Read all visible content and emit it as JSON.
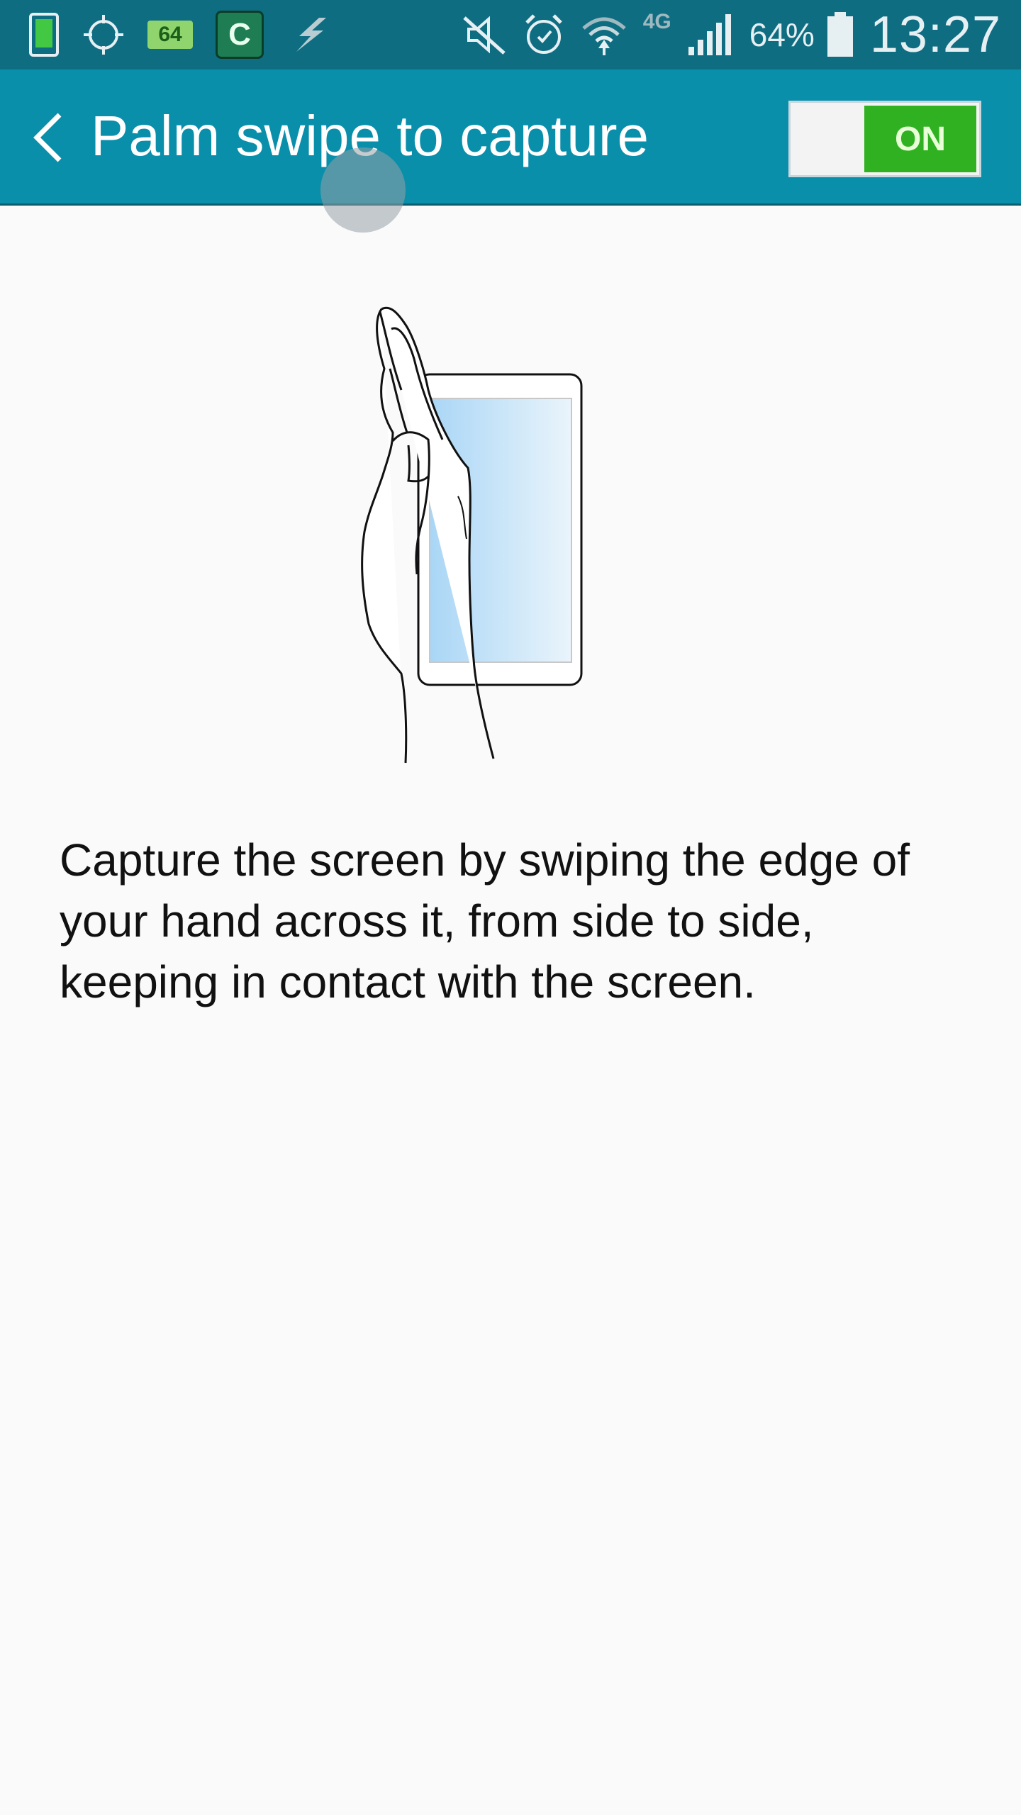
{
  "status_bar": {
    "notification_icons": [
      "phone-icon",
      "gps-icon",
      "badge-64-icon",
      "c-app-icon",
      "flash-icon"
    ],
    "badge_64_text": "64",
    "c_app_text": "C",
    "system_icons": [
      "mute-icon",
      "alarm-icon",
      "wifi-icon",
      "4g-lte-icon",
      "signal-icon",
      "battery-icon"
    ],
    "network_label": "4G",
    "battery_percent": "64%",
    "battery_level": 0.64,
    "clock": "13:27"
  },
  "header": {
    "title": "Palm swipe to capture",
    "back_icon": "chevron-left-icon",
    "toggle_label": "ON",
    "toggle_state": true
  },
  "main": {
    "illustration": "hand-swiping-phone-illustration",
    "description": "Capture the screen by swiping the edge of your hand across it, from side to side, keeping in contact with the screen."
  },
  "colors": {
    "status_bar": "#0f6d82",
    "action_bar": "#0a8fab",
    "toggle_on": "#2fb121",
    "background": "#fafafa"
  }
}
